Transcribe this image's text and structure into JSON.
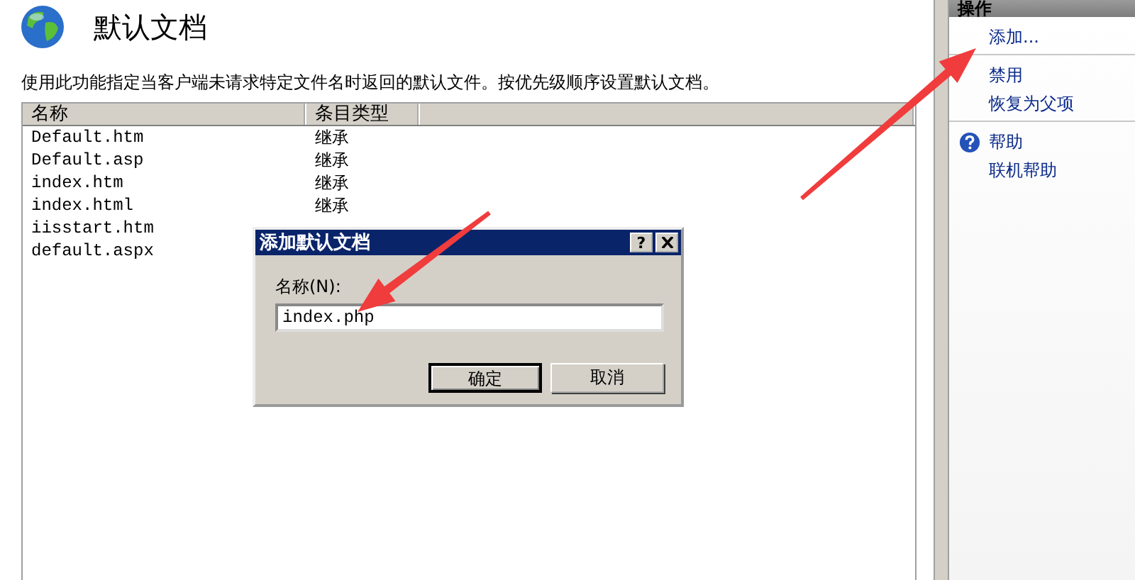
{
  "page": {
    "title": "默认文档",
    "description": "使用此功能指定当客户端未请求特定文件名时返回的默认文件。按优先级顺序设置默认文档。"
  },
  "table": {
    "columns": [
      "名称",
      "条目类型"
    ],
    "rows": [
      {
        "name": "Default.htm",
        "entry_type": "继承"
      },
      {
        "name": "Default.asp",
        "entry_type": "继承"
      },
      {
        "name": "index.htm",
        "entry_type": "继承"
      },
      {
        "name": "index.html",
        "entry_type": "继承"
      },
      {
        "name": "iisstart.htm"
      },
      {
        "name": "default.aspx"
      }
    ]
  },
  "actions": {
    "title": "操作",
    "groups": [
      {
        "items": [
          {
            "label": "添加...",
            "kind": "link"
          }
        ]
      },
      {
        "items": [
          {
            "label": "禁用",
            "kind": "link"
          },
          {
            "label": "恢复为父项",
            "kind": "link"
          }
        ]
      },
      {
        "items": [
          {
            "label": "帮助",
            "kind": "help"
          },
          {
            "label": "联机帮助",
            "kind": "link"
          }
        ]
      }
    ]
  },
  "dialog": {
    "title": "添加默认文档",
    "help_button": "?",
    "field_label": "名称(N):",
    "value": "index.php",
    "buttons": [
      {
        "label": "确定",
        "default": true
      },
      {
        "label": "取消",
        "default": false
      }
    ]
  }
}
